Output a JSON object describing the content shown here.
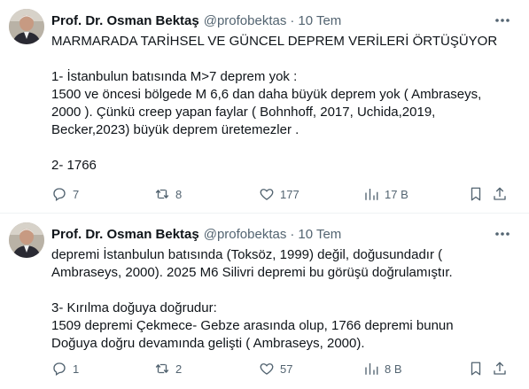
{
  "tweets": [
    {
      "author_name": "Prof. Dr. Osman Bektaş",
      "handle": "@profobektas",
      "separator": "·",
      "date": "10 Tem",
      "lines": [
        "MARMARADA TARİHSEL VE GÜNCEL DEPREM VERİLERİ ÖRTÜŞÜYOR",
        "",
        "1- İstanbulun batısında M>7 deprem yok :",
        "1500 ve öncesi bölgede M 6,6 dan daha büyük deprem yok ( Ambraseys,",
        "2000 ). Çünkü creep yapan faylar ( Bohnhoff, 2017, Uchida,2019,",
        "Becker,2023) büyük deprem üretemezler .",
        "",
        "2- 1766"
      ],
      "replies": "7",
      "reposts": "8",
      "likes": "177",
      "views": "17 B"
    },
    {
      "author_name": "Prof. Dr. Osman Bektaş",
      "handle": "@profobektas",
      "separator": "·",
      "date": "10 Tem",
      "lines": [
        "depremi İstanbulun batısında (Toksöz, 1999) değil, doğusundadır (",
        "Ambraseys, 2000). 2025 M6 Silivri depremi bu görüşü doğrulamıştır.",
        "",
        "3- Kırılma doğuya doğrudur:",
        "1509 depremi Çekmece- Gebze arasında olup, 1766 depremi  bunun",
        "Doğuya doğru devamında gelişti ( Ambraseys, 2000)."
      ],
      "replies": "1",
      "reposts": "2",
      "likes": "57",
      "views": "8 B"
    }
  ],
  "colors": {
    "text": "#0f1419",
    "secondary": "#536471",
    "divider": "#eff3f4"
  },
  "icons": [
    "more-icon",
    "reply-icon",
    "repost-icon",
    "like-icon",
    "views-icon",
    "bookmark-icon",
    "share-icon"
  ]
}
